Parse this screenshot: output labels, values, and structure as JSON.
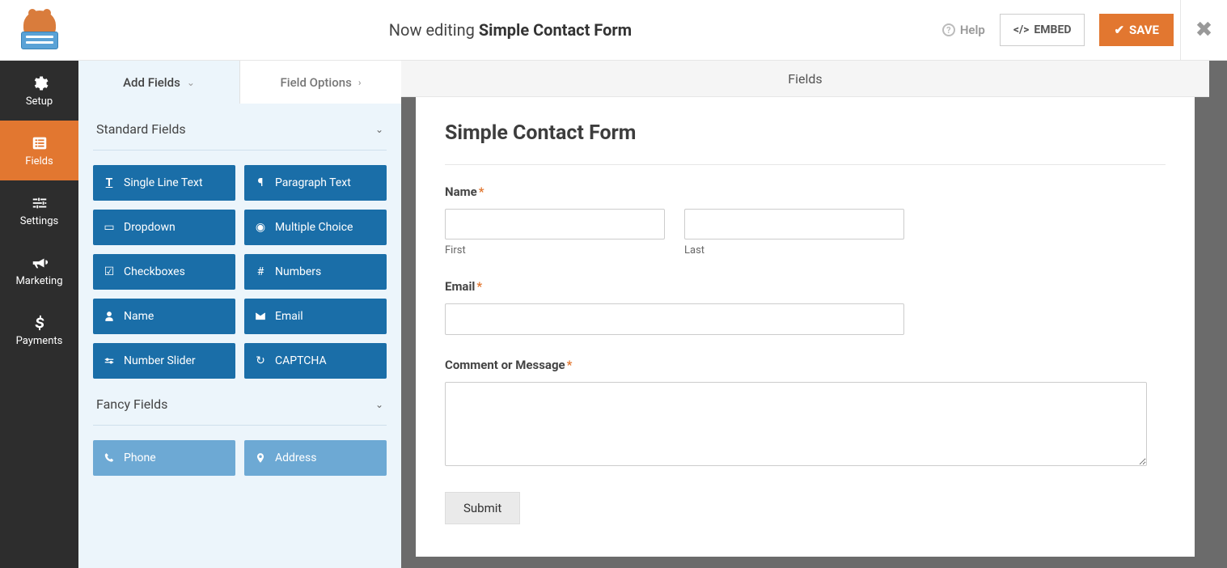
{
  "header": {
    "editing_prefix": "Now editing ",
    "form_name": "Simple Contact Form",
    "help_label": "Help",
    "embed_label": "EMBED",
    "save_label": "SAVE"
  },
  "nav": {
    "items": [
      {
        "label": "Setup",
        "icon": "gear"
      },
      {
        "label": "Fields",
        "icon": "list"
      },
      {
        "label": "Settings",
        "icon": "sliders"
      },
      {
        "label": "Marketing",
        "icon": "bullhorn"
      },
      {
        "label": "Payments",
        "icon": "dollar"
      }
    ],
    "active_index": 1
  },
  "panel": {
    "tabs": {
      "add": "Add Fields",
      "options": "Field Options"
    },
    "sections": {
      "standard": {
        "title": "Standard Fields",
        "fields": [
          {
            "label": "Single Line Text",
            "icon": "text"
          },
          {
            "label": "Paragraph Text",
            "icon": "paragraph"
          },
          {
            "label": "Dropdown",
            "icon": "dropdown"
          },
          {
            "label": "Multiple Choice",
            "icon": "radio"
          },
          {
            "label": "Checkboxes",
            "icon": "check"
          },
          {
            "label": "Numbers",
            "icon": "hash"
          },
          {
            "label": "Name",
            "icon": "user"
          },
          {
            "label": "Email",
            "icon": "envelope"
          },
          {
            "label": "Number Slider",
            "icon": "slider"
          },
          {
            "label": "CAPTCHA",
            "icon": "recaptcha"
          }
        ]
      },
      "fancy": {
        "title": "Fancy Fields",
        "fields": [
          {
            "label": "Phone",
            "icon": "phone"
          },
          {
            "label": "Address",
            "icon": "pin"
          }
        ]
      }
    }
  },
  "canvas": {
    "header_label": "Fields",
    "form_title": "Simple Contact Form",
    "fields": {
      "name": {
        "label": "Name",
        "required": true,
        "first_sub": "First",
        "last_sub": "Last"
      },
      "email": {
        "label": "Email",
        "required": true
      },
      "message": {
        "label": "Comment or Message",
        "required": true
      }
    },
    "submit_label": "Submit"
  },
  "icons": {
    "text": "T",
    "paragraph": "¶",
    "dropdown": "▾",
    "radio": "◉",
    "check": "☑",
    "hash": "#",
    "user": "👤",
    "envelope": "✉",
    "slider": "⟷",
    "recaptcha": "↻",
    "phone": "📞",
    "pin": "📍"
  }
}
